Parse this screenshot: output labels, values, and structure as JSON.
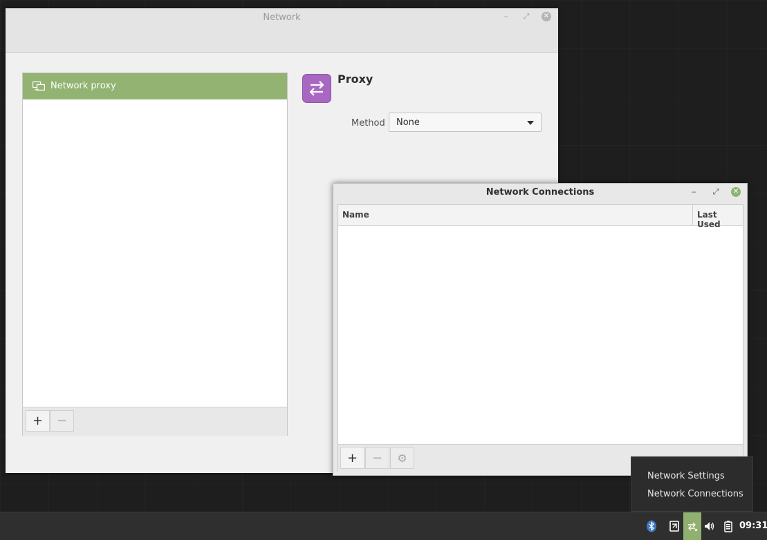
{
  "network_window": {
    "title": "Network",
    "list_items": [
      {
        "label": "Network proxy",
        "icon": "network-proxy-icon"
      }
    ],
    "add_label": "+",
    "remove_label": "−",
    "section_title": "Proxy",
    "method_label": "Method",
    "method_value": "None"
  },
  "connections_window": {
    "title": "Network Connections",
    "columns": [
      "Name",
      "Last Used"
    ],
    "rows": [],
    "add_label": "+",
    "remove_label": "−",
    "settings_label": "⚙"
  },
  "popup_menu": {
    "items": [
      "Network Settings",
      "Network Connections"
    ]
  },
  "panel": {
    "clock": "09:31",
    "tray_icons": [
      "bluetooth-icon",
      "update-manager-icon",
      "network-icon",
      "volume-icon",
      "battery-icon"
    ],
    "highlight_color": "#8fb06f"
  },
  "colors": {
    "accent": "#92b372",
    "proxy_icon": "#a868c2"
  }
}
